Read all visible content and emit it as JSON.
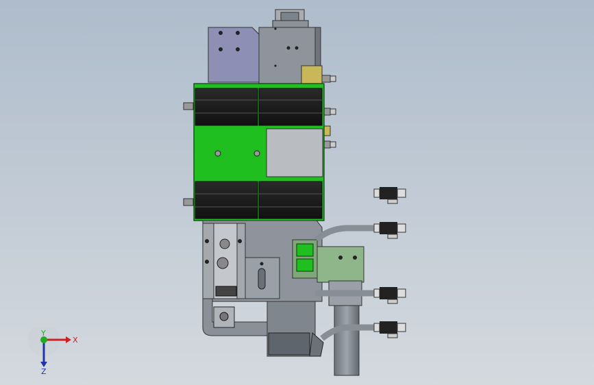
{
  "viewport": {
    "background_top": "#aebccb",
    "background_bottom": "#d4d9de"
  },
  "model": {
    "view": "front",
    "colors": {
      "body_grey": "#8f949c",
      "body_dark": "#6f757d",
      "plate_lavender": "#8e8fb5",
      "panel_green": "#1fbf1f",
      "panel_dark": "#1b1b1b",
      "bracket_green": "#8fb58a",
      "cover_grey": "#b9bcc0",
      "brass": "#c9b85a",
      "connector_black": "#222222"
    }
  },
  "triad": {
    "x_label": "X",
    "y_label": "Y",
    "z_label": "Z",
    "x_color": "#cc2222",
    "y_color": "#22aa22",
    "z_color": "#2233aa"
  }
}
